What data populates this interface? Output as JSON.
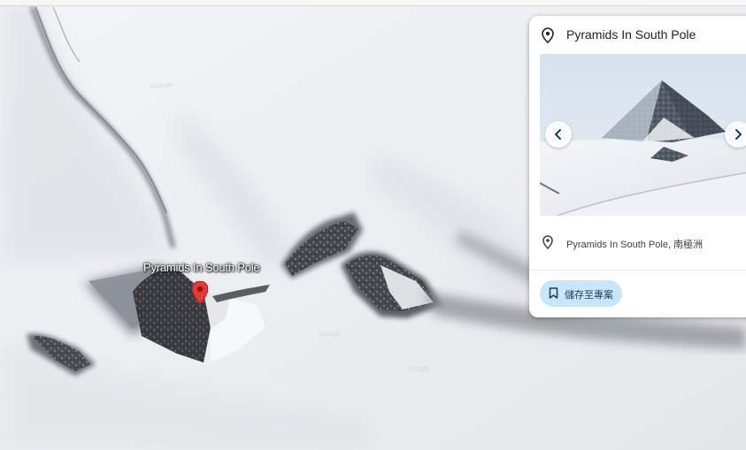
{
  "map": {
    "place_label": "Pyramids In South Pole",
    "marker_color": "#e53935"
  },
  "card": {
    "title": "Pyramids In South Pole",
    "photo_prev_icon": "chevron-left-icon",
    "photo_next_icon": "chevron-right-icon",
    "address": "Pyramids In South Pole, 南極洲",
    "save_label": "儲存至專案",
    "save_button_color": "#c8e6fb"
  }
}
